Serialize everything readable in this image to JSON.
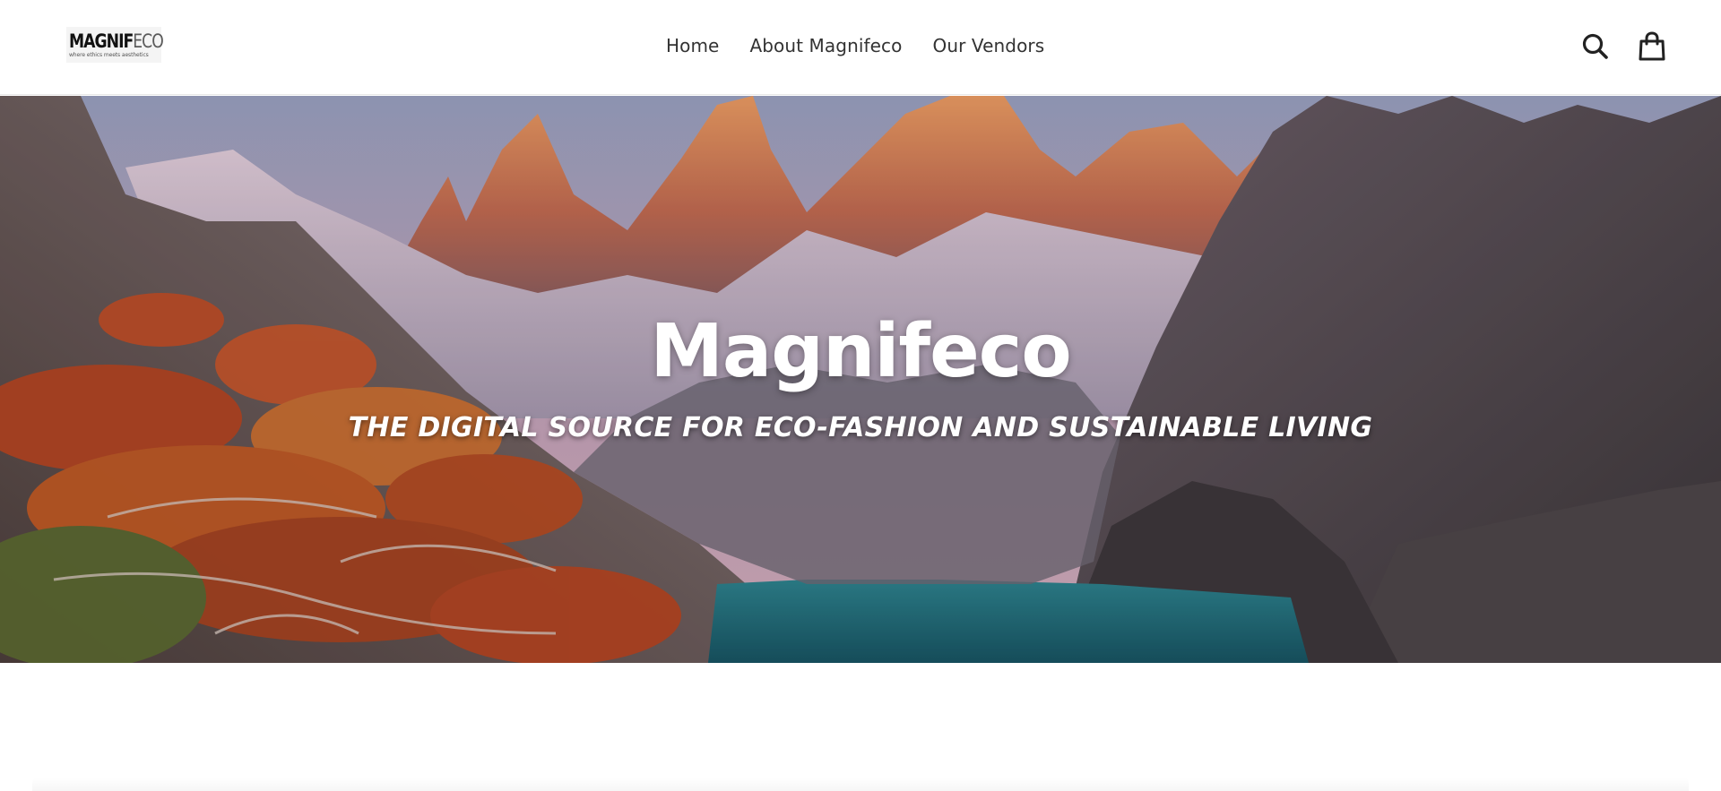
{
  "logo": {
    "word_dark": "MAGNIF",
    "word_light": "ECO",
    "tagline": "where ethics meets aesthetics"
  },
  "nav": {
    "items": [
      {
        "label": "Home"
      },
      {
        "label": "About Magnifeco"
      },
      {
        "label": "Our Vendors"
      }
    ]
  },
  "header_icons": {
    "search": "search-icon",
    "cart": "shopping-bag-icon"
  },
  "hero": {
    "title": "Magnifeco",
    "subtitle": "THE DIGITAL SOURCE FOR ECO-FASHION AND SUSTAINABLE LIVING",
    "image": "mountain-lake-landscape"
  },
  "colors": {
    "text": "#333333",
    "hero_text": "#ffffff",
    "lake": "#1f6f7a",
    "foliage": "#b8451f"
  }
}
